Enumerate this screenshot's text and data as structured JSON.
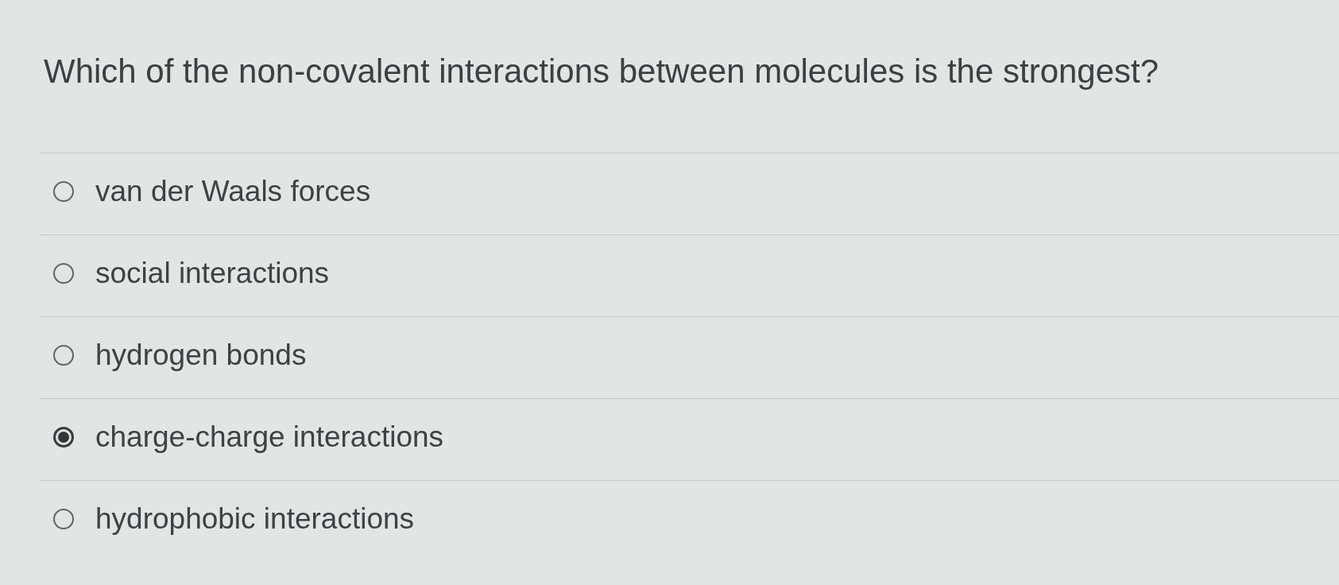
{
  "question": "Which of the non-covalent interactions between molecules is the strongest?",
  "options": [
    {
      "label": "van der Waals forces",
      "selected": false
    },
    {
      "label": "social interactions",
      "selected": false
    },
    {
      "label": "hydrogen bonds",
      "selected": false
    },
    {
      "label": "charge-charge interactions",
      "selected": true
    },
    {
      "label": "hydrophobic interactions",
      "selected": false
    }
  ]
}
